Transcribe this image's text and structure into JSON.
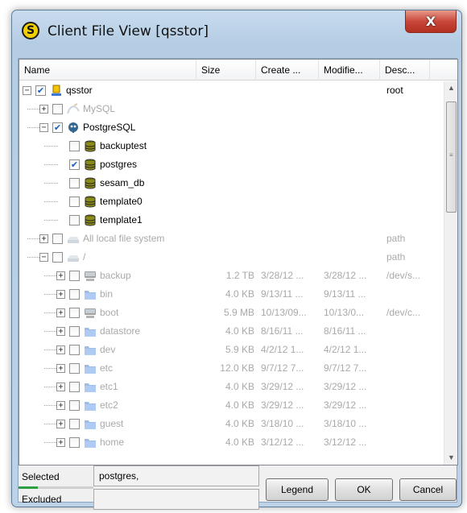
{
  "window": {
    "title": "Client File View [qsstor]",
    "close_glyph": "X",
    "app_icon_glyph": "S"
  },
  "columns": [
    "Name",
    "Size",
    "Create ...",
    "Modifie...",
    "Desc..."
  ],
  "rows": [
    {
      "label": "qsstor",
      "icon": "computer-icon",
      "checked": true,
      "expander": "−",
      "level": 0,
      "dim": false,
      "size": "",
      "created": "",
      "modified": "",
      "desc": "root"
    },
    {
      "label": "MySQL",
      "icon": "mysql-icon",
      "checked": false,
      "expander": "+",
      "level": 1,
      "dim": true,
      "size": "",
      "created": "",
      "modified": "",
      "desc": ""
    },
    {
      "label": "PostgreSQL",
      "icon": "postgresql-icon",
      "checked": true,
      "expander": "−",
      "level": 1,
      "dim": false,
      "size": "",
      "created": "",
      "modified": "",
      "desc": ""
    },
    {
      "label": "backuptest",
      "icon": "database-icon",
      "checked": false,
      "expander": "",
      "level": 2,
      "dim": false,
      "size": "",
      "created": "",
      "modified": "",
      "desc": ""
    },
    {
      "label": "postgres",
      "icon": "database-icon",
      "checked": true,
      "expander": "",
      "level": 2,
      "dim": false,
      "size": "",
      "created": "",
      "modified": "",
      "desc": ""
    },
    {
      "label": "sesam_db",
      "icon": "database-icon",
      "checked": false,
      "expander": "",
      "level": 2,
      "dim": false,
      "size": "",
      "created": "",
      "modified": "",
      "desc": ""
    },
    {
      "label": "template0",
      "icon": "database-icon",
      "checked": false,
      "expander": "",
      "level": 2,
      "dim": false,
      "size": "",
      "created": "",
      "modified": "",
      "desc": ""
    },
    {
      "label": "template1",
      "icon": "database-icon",
      "checked": false,
      "expander": "",
      "level": 2,
      "dim": false,
      "size": "",
      "created": "",
      "modified": "",
      "desc": ""
    },
    {
      "label": "All local file system",
      "icon": "drive-icon",
      "checked": false,
      "expander": "+",
      "level": 1,
      "dim": true,
      "size": "",
      "created": "",
      "modified": "",
      "desc": "path"
    },
    {
      "label": "/",
      "icon": "drive-icon",
      "checked": false,
      "expander": "−",
      "level": 1,
      "dim": true,
      "size": "",
      "created": "",
      "modified": "",
      "desc": "path"
    },
    {
      "label": "backup",
      "icon": "mount-icon",
      "checked": false,
      "expander": "+",
      "level": 2,
      "dim": true,
      "size": "1.2 TB",
      "created": "3/28/12 ...",
      "modified": "3/28/12 ...",
      "desc": "/dev/s..."
    },
    {
      "label": "bin",
      "icon": "folder-icon",
      "checked": false,
      "expander": "+",
      "level": 2,
      "dim": true,
      "size": "4.0 KB",
      "created": "9/13/11 ...",
      "modified": "9/13/11 ...",
      "desc": ""
    },
    {
      "label": "boot",
      "icon": "mount-icon",
      "checked": false,
      "expander": "+",
      "level": 2,
      "dim": true,
      "size": "5.9 MB",
      "created": "10/13/09...",
      "modified": "10/13/0...",
      "desc": "/dev/c..."
    },
    {
      "label": "datastore",
      "icon": "folder-icon",
      "checked": false,
      "expander": "+",
      "level": 2,
      "dim": true,
      "size": "4.0 KB",
      "created": "8/16/11 ...",
      "modified": "8/16/11 ...",
      "desc": ""
    },
    {
      "label": "dev",
      "icon": "folder-icon",
      "checked": false,
      "expander": "+",
      "level": 2,
      "dim": true,
      "size": "5.9 KB",
      "created": "4/2/12 1...",
      "modified": "4/2/12 1...",
      "desc": ""
    },
    {
      "label": "etc",
      "icon": "folder-icon",
      "checked": false,
      "expander": "+",
      "level": 2,
      "dim": true,
      "size": "12.0 KB",
      "created": "9/7/12 7...",
      "modified": "9/7/12 7...",
      "desc": ""
    },
    {
      "label": "etc1",
      "icon": "folder-icon",
      "checked": false,
      "expander": "+",
      "level": 2,
      "dim": true,
      "size": "4.0 KB",
      "created": "3/29/12 ...",
      "modified": "3/29/12 ...",
      "desc": ""
    },
    {
      "label": "etc2",
      "icon": "folder-icon",
      "checked": false,
      "expander": "+",
      "level": 2,
      "dim": true,
      "size": "4.0 KB",
      "created": "3/29/12 ...",
      "modified": "3/29/12 ...",
      "desc": ""
    },
    {
      "label": "guest",
      "icon": "folder-icon",
      "checked": false,
      "expander": "+",
      "level": 2,
      "dim": true,
      "size": "4.0 KB",
      "created": "3/18/10 ...",
      "modified": "3/18/10 ...",
      "desc": ""
    },
    {
      "label": "home",
      "icon": "folder-icon",
      "checked": false,
      "expander": "+",
      "level": 2,
      "dim": true,
      "size": "4.0 KB",
      "created": "3/12/12 ...",
      "modified": "3/12/12 ...",
      "desc": ""
    }
  ],
  "status": {
    "selected_label": "Selected",
    "selected_value": "postgres,",
    "excluded_label": "Excluded",
    "excluded_value": ""
  },
  "buttons": {
    "legend": "Legend",
    "ok": "OK",
    "cancel": "Cancel"
  },
  "scrollbar": {
    "up_glyph": "▲",
    "down_glyph": "▼",
    "grip": "≡"
  },
  "colors": {
    "folder": "#5b8fd8",
    "database": "#5a5a00",
    "check": "#1d5fbe",
    "dim_text": "#a9a9a9"
  }
}
